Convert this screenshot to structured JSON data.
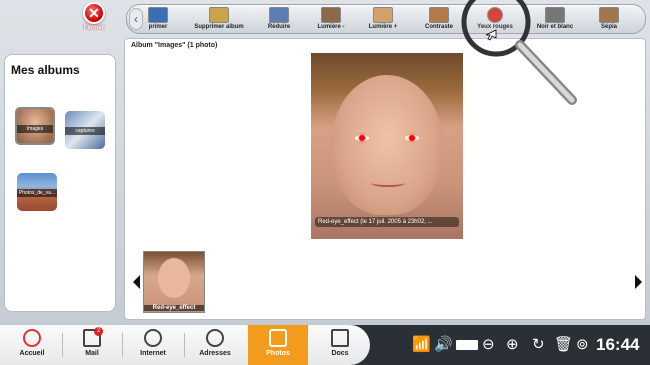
{
  "close": {
    "label": "Fermer"
  },
  "toolbar": {
    "items": [
      {
        "label": "primer",
        "icon": "printer-icon",
        "color": "#3a6fb3"
      },
      {
        "label": "Supprimer album",
        "icon": "folder-delete-icon",
        "color": "#c9a44a"
      },
      {
        "label": "Réduire",
        "icon": "reduce-icon",
        "color": "#5b7fb0"
      },
      {
        "label": "Lumière -",
        "icon": "light-minus-icon",
        "color": "#8a6a4a"
      },
      {
        "label": "Lumière +",
        "icon": "light-plus-icon",
        "color": "#d1a26b"
      },
      {
        "label": "Contraste",
        "icon": "contrast-icon",
        "color": "#b07a4a"
      },
      {
        "label": "Yeux rouges",
        "icon": "red-eye-icon",
        "color": "#d0362e"
      },
      {
        "label": "Noir et blanc",
        "icon": "black-white-icon",
        "color": "#777777"
      },
      {
        "label": "Sépia",
        "icon": "sepia-icon",
        "color": "#a07850"
      }
    ]
  },
  "sidebar": {
    "title": "Mes albums",
    "albums": [
      {
        "label": "Images"
      },
      {
        "label": "captures"
      },
      {
        "label": "Photos_de_va..."
      }
    ]
  },
  "main": {
    "album_title": "Album \"Images\" (1 photo)",
    "photo_caption": "Red-eye_effect (le 17 juil. 2005 à 23h02, ...",
    "film_label": "Red-eye_effect"
  },
  "taskbar": {
    "apps": [
      {
        "label": "Accueil",
        "icon": "home-icon"
      },
      {
        "label": "Mail",
        "icon": "mail-icon",
        "badge": "2"
      },
      {
        "label": "Internet",
        "icon": "globe-icon"
      },
      {
        "label": "Adresses",
        "icon": "contacts-icon"
      },
      {
        "label": "Photos",
        "icon": "camera-icon",
        "active": true
      },
      {
        "label": "Docs",
        "icon": "documents-icon"
      }
    ],
    "time": "16:44"
  },
  "accent": "#f29b1d"
}
